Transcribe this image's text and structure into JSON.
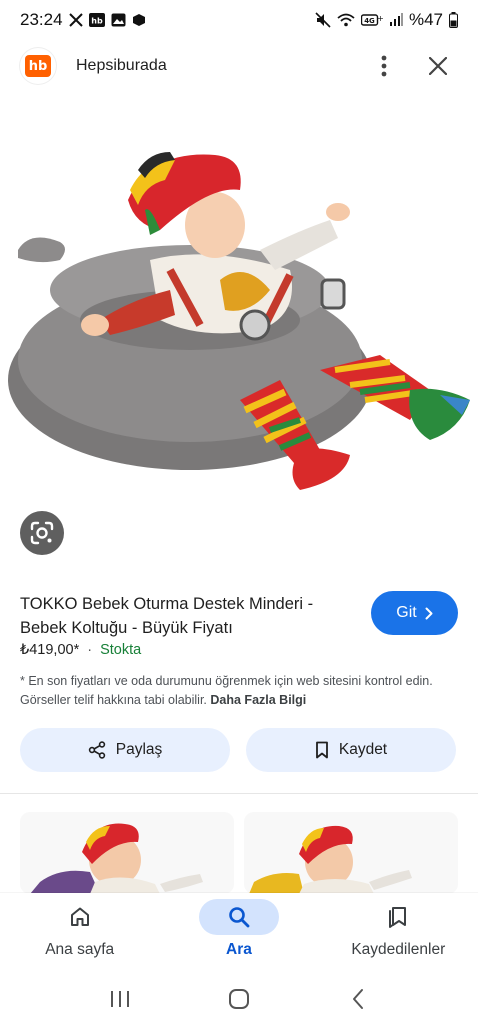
{
  "status_bar": {
    "time": "23:24",
    "battery_percent": "%47"
  },
  "header": {
    "logo_text": "hb",
    "site_name": "Hepsiburada"
  },
  "product": {
    "title": "TOKKO Bebek Oturma Destek Minderi - Bebek Koltuğu - Büyük Fiyatı",
    "price": "₺419,00*",
    "separator": "·",
    "stock": "Stokta",
    "disclaimer": "* En son fiyatları ve oda durumunu öğrenmek için web sitesini kontrol edin. Görseller telif hakkına tabi olabilir.",
    "more_info": "Daha Fazla Bilgi",
    "go_label": "Git"
  },
  "actions": {
    "share_label": "Paylaş",
    "save_label": "Kaydet"
  },
  "bottom_nav": {
    "items": [
      {
        "label": "Ana sayfa",
        "icon": "home-icon",
        "active": false
      },
      {
        "label": "Ara",
        "icon": "search-icon",
        "active": true
      },
      {
        "label": "Kaydedilenler",
        "icon": "saved-icon",
        "active": false
      }
    ]
  },
  "colors": {
    "accent": "#1a73e8",
    "brand": "#ff6000",
    "stock_green": "#188038",
    "button_bg": "#e8f0fe"
  }
}
